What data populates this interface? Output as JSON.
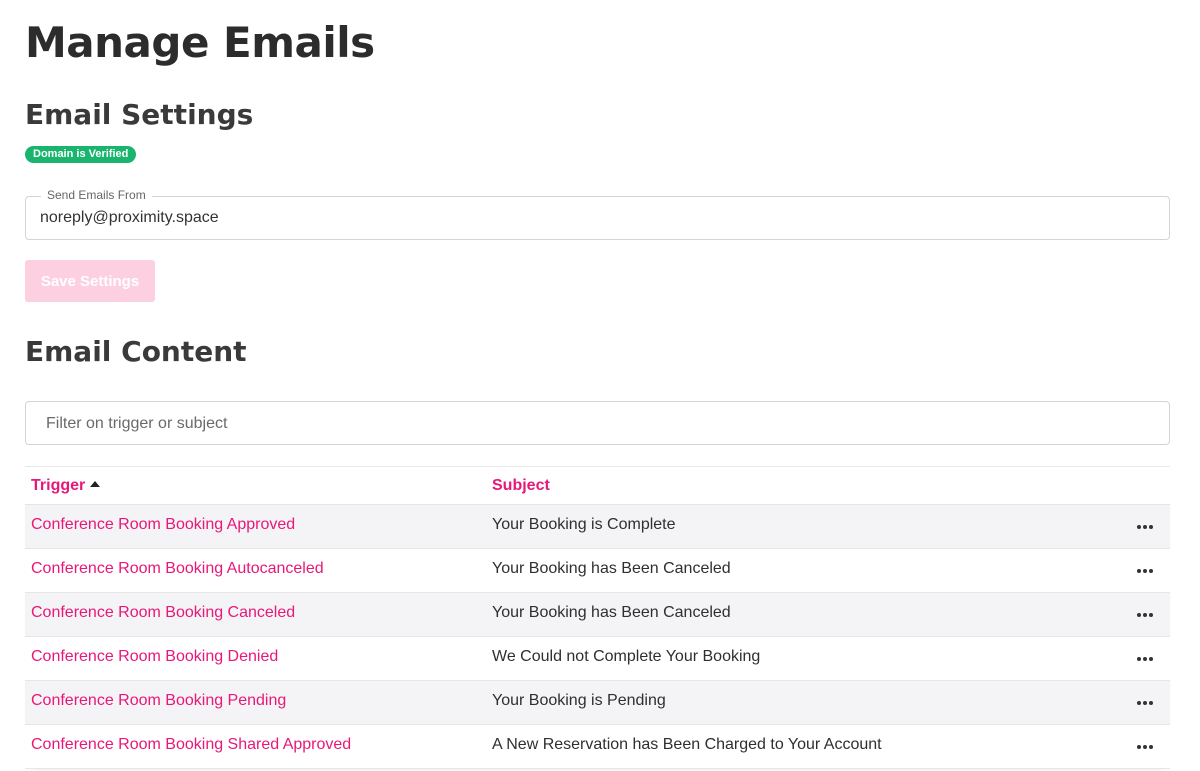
{
  "page": {
    "title": "Manage Emails"
  },
  "settings": {
    "title": "Email Settings",
    "badge": "Domain is Verified",
    "field_label": "Send Emails From",
    "field_value": "noreply@proximity.space",
    "save_label": "Save Settings"
  },
  "content": {
    "title": "Email Content",
    "filter_placeholder": "Filter on trigger or subject",
    "columns": {
      "trigger": "Trigger",
      "subject": "Subject"
    },
    "rows": [
      {
        "trigger": "Conference Room Booking Approved",
        "subject": "Your Booking is Complete"
      },
      {
        "trigger": "Conference Room Booking Autocanceled",
        "subject": "Your Booking has Been Canceled"
      },
      {
        "trigger": "Conference Room Booking Canceled",
        "subject": "Your Booking has Been Canceled"
      },
      {
        "trigger": "Conference Room Booking Denied",
        "subject": "We Could not Complete Your Booking"
      },
      {
        "trigger": "Conference Room Booking Pending",
        "subject": "Your Booking is Pending"
      },
      {
        "trigger": "Conference Room Booking Shared Approved",
        "subject": "A New Reservation has Been Charged to Your Account"
      }
    ]
  },
  "colors": {
    "accent": "#e8177a",
    "verified": "#19b46e",
    "button_disabled": "#fdd0e1"
  }
}
